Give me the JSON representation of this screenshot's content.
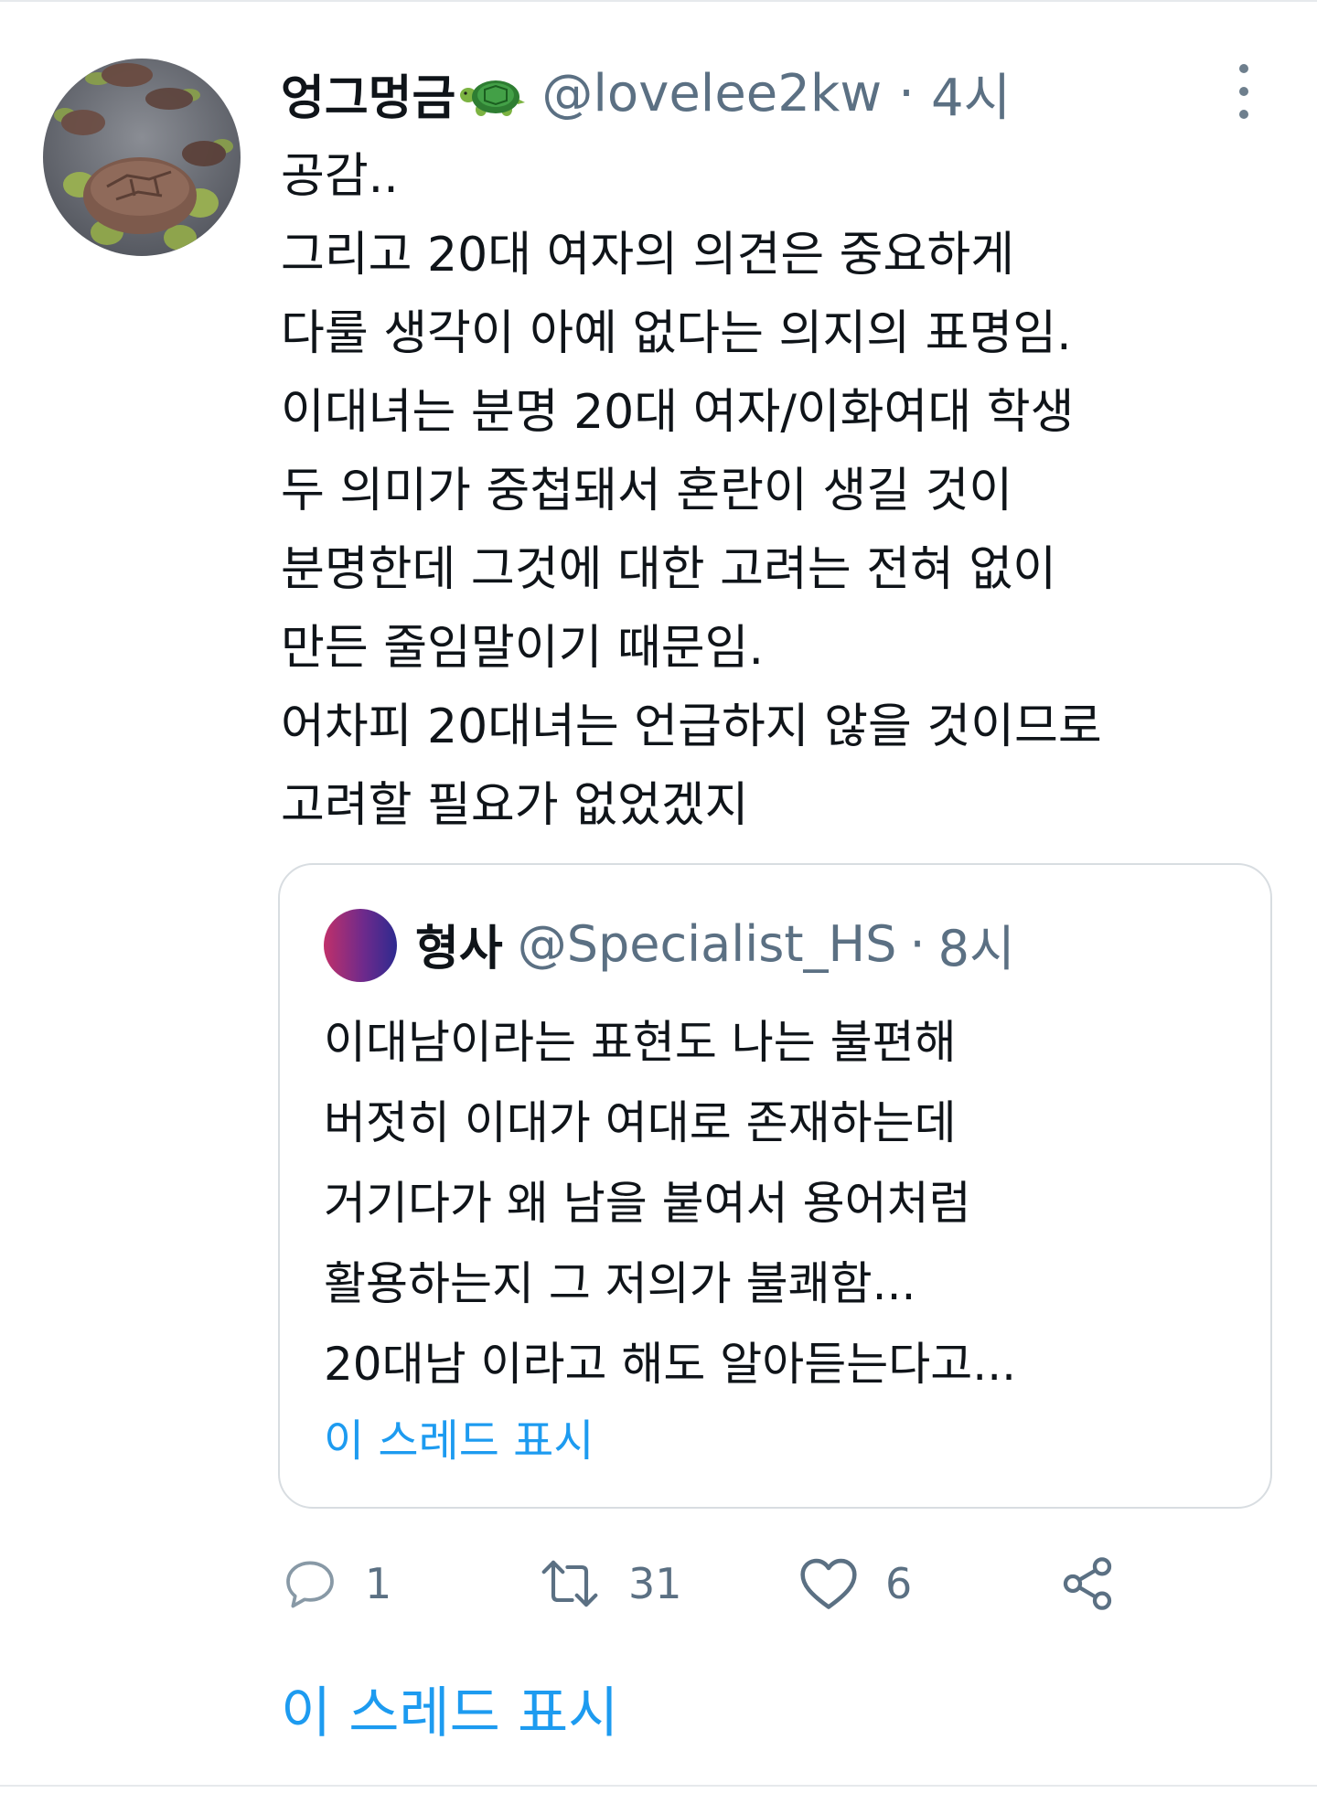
{
  "tweet": {
    "display_name": "엉그멍금",
    "name_emoji": "turtle-emoji",
    "handle": "@lovelee2kw",
    "separator": "·",
    "time": "4시",
    "lines": [
      "공감..",
      "그리고 20대 여자의 의견은 중요하게",
      "다룰 생각이 아예 없다는 의지의 표명임.",
      "이대녀는 분명 20대 여자/이화여대 학생",
      "두 의미가 중첩돼서 혼란이 생길 것이",
      "분명한데 그것에 대한 고려는 전혀 없이",
      "만든 줄임말이기 때문임.",
      "어차피 20대녀는 언급하지 않을 것이므로",
      "고려할 필요가 없었겠지"
    ]
  },
  "quote": {
    "display_name": "형사",
    "handle": "@Specialist_HS",
    "separator": "·",
    "time": "8시",
    "lines": [
      "이대남이라는 표현도 나는 불편해",
      "버젓히 이대가 여대로 존재하는데",
      "거기다가 왜 남을 붙여서 용어처럼",
      "활용하는지 그 저의가 불쾌함...",
      "20대남 이라고 해도 알아듣는다고..."
    ],
    "show_thread": "이 스레드 표시"
  },
  "actions": {
    "reply_count": "1",
    "retweet_count": "31",
    "like_count": "6"
  },
  "show_thread": "이 스레드 표시",
  "colors": {
    "link": "#1d9bf0",
    "secondary_text": "#5b7083",
    "border": "#d8dde1"
  }
}
